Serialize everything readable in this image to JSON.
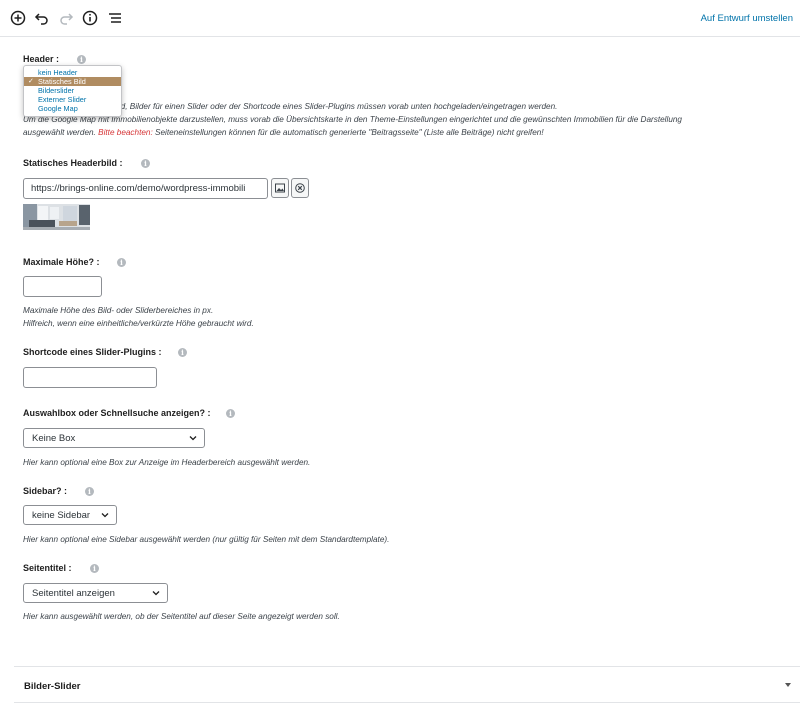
{
  "toolbar": {
    "icons": [
      "add-block-icon",
      "undo-icon",
      "redo-icon",
      "info-icon",
      "list-view-icon"
    ],
    "switch_to_draft": "Auf Entwurf umstellen"
  },
  "header_field": {
    "label": "Header :",
    "options": [
      "kein Header",
      "Statisches Bild",
      "Bilderslider",
      "Externer Slider",
      "Google Map"
    ],
    "selected": "Statisches Bild",
    "desc_line1_partial": "ild, Bilder für einen Slider oder der Shortcode eines Slider-Plugins müssen vorab unten hochgeladen/eingetragen werden.",
    "desc_line2": "Um die Google Map mit Immobilienobjekte darzustellen, muss vorab die Übersichtskarte in den Theme-Einstellungen eingerichtet und die gewünschten Immobilien für die Darstellung",
    "desc_line3_start": "ausgewählt werden. ",
    "desc_warning": "Bitte beachten:",
    "desc_line3_end": " Seiteneinstellungen können für die automatisch generierte \"Beitragsseite\" (Liste alle Beiträge) nicht greifen!"
  },
  "static_image": {
    "label": "Statisches Headerbild :",
    "url_value": "https://brings-online.com/demo/wordpress-immobili"
  },
  "max_height": {
    "label": "Maximale Höhe? :",
    "value": "",
    "desc_line1": "Maximale Höhe des Bild- oder Sliderbereiches in px.",
    "desc_line2": "Hilfreich, wenn eine einheitliche/verkürzte Höhe gebraucht wird."
  },
  "shortcode": {
    "label": "Shortcode eines Slider-Plugins :",
    "value": ""
  },
  "search_box": {
    "label": "Auswahlbox oder Schnellsuche anzeigen? :",
    "selected": "Keine Box",
    "desc": "Hier kann optional eine Box zur Anzeige im Headerbereich ausgewählt werden."
  },
  "sidebar": {
    "label": "Sidebar? :",
    "selected": "keine Sidebar",
    "desc": "Hier kann optional eine Sidebar ausgewählt werden (nur gültig für Seiten mit dem Standardtemplate)."
  },
  "page_title": {
    "label": "Seitentitel :",
    "selected": "Seitentitel anzeigen",
    "desc": "Hier kann ausgewählt werden, ob der Seitentitel auf dieser Seite angezeigt werden soll."
  },
  "bilder_slider": {
    "title": "Bilder-Slider"
  },
  "colors": {
    "link": "#0073aa",
    "warning": "#d63638",
    "selected_option_bg": "#b08c61"
  }
}
